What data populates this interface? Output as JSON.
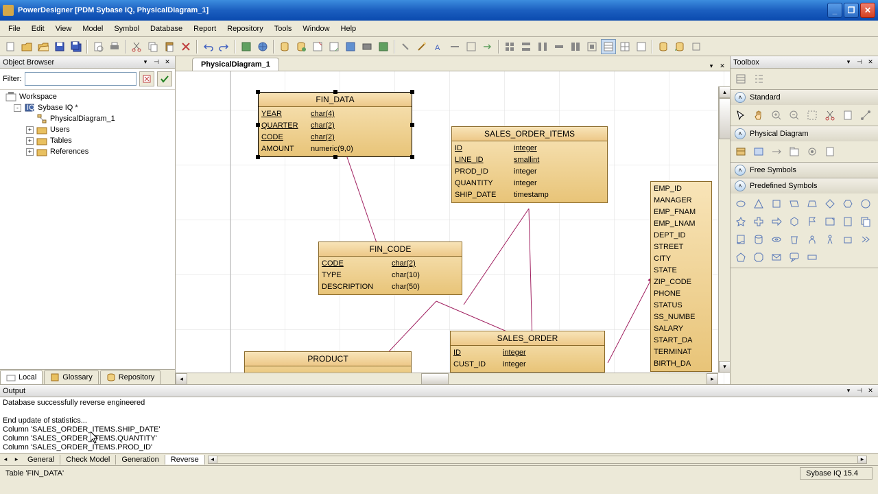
{
  "title": "PowerDesigner [PDM Sybase IQ, PhysicalDiagram_1]",
  "menu": [
    "File",
    "Edit",
    "View",
    "Model",
    "Symbol",
    "Database",
    "Report",
    "Repository",
    "Tools",
    "Window",
    "Help"
  ],
  "objectBrowser": {
    "title": "Object Browser",
    "filterLabel": "Filter:",
    "tree": {
      "root": "Workspace",
      "model": "Sybase IQ *",
      "diagram": "PhysicalDiagram_1",
      "folders": [
        "Users",
        "Tables",
        "References"
      ]
    },
    "tabs": [
      "Local",
      "Glossary",
      "Repository"
    ]
  },
  "diagramTab": "PhysicalDiagram_1",
  "entities": {
    "fin_data": {
      "name": "FIN_DATA",
      "cols": [
        {
          "n": "YEAR",
          "t": "char(4)",
          "k": "<pk>",
          "u": true
        },
        {
          "n": "QUARTER",
          "t": "char(2)",
          "k": "<pk>",
          "u": true
        },
        {
          "n": "CODE",
          "t": "char(2)",
          "k": "<pk,fk>",
          "u": true
        },
        {
          "n": "AMOUNT",
          "t": "numeric(9,0)",
          "k": "",
          "u": false
        }
      ]
    },
    "sales_order_items": {
      "name": "SALES_ORDER_ITEMS",
      "cols": [
        {
          "n": "ID",
          "t": "integer",
          "k": "<pk,fk1>",
          "u": true
        },
        {
          "n": "LINE_ID",
          "t": "smallint",
          "k": "<pk>",
          "u": true
        },
        {
          "n": "PROD_ID",
          "t": "integer",
          "k": "<fk2>",
          "u": false
        },
        {
          "n": "QUANTITY",
          "t": "integer",
          "k": "",
          "u": false
        },
        {
          "n": "SHIP_DATE",
          "t": "timestamp",
          "k": "",
          "u": false
        }
      ]
    },
    "fin_code": {
      "name": "FIN_CODE",
      "cols": [
        {
          "n": "CODE",
          "t": "char(2)",
          "k": "<pk>",
          "u": true
        },
        {
          "n": "TYPE",
          "t": "char(10)",
          "k": "",
          "u": false
        },
        {
          "n": "DESCRIPTION",
          "t": "char(50)",
          "k": "",
          "u": false
        }
      ]
    },
    "sales_order": {
      "name": "SALES_ORDER",
      "cols": [
        {
          "n": "ID",
          "t": "integer",
          "k": "<pk>",
          "u": true
        },
        {
          "n": "CUST_ID",
          "t": "integer",
          "k": "<fk3>",
          "u": false
        }
      ]
    },
    "product": {
      "name": "PRODUCT",
      "cols": []
    },
    "employee": {
      "cols": [
        "EMP_ID",
        "MANAGER",
        "EMP_FNAM",
        "EMP_LNAM",
        "DEPT_ID",
        "STREET",
        "CITY",
        "STATE",
        "ZIP_CODE",
        "PHONE",
        "STATUS",
        "SS_NUMBE",
        "SALARY",
        "START_DA",
        "TERMINAT",
        "BIRTH_DA"
      ]
    }
  },
  "toolbox": {
    "title": "Toolbox",
    "sections": [
      "Standard",
      "Physical Diagram",
      "Free Symbols",
      "Predefined Symbols"
    ]
  },
  "output": {
    "title": "Output",
    "lines": [
      "Column 'SALES_ORDER_ITEMS.PROD_ID'",
      "Column 'SALES_ORDER_ITEMS.QUANTITY'",
      "Column 'SALES_ORDER_ITEMS.SHIP_DATE'",
      "End update of statistics...",
      "",
      "Database successfully reverse engineered"
    ],
    "tabs": [
      "General",
      "Check Model",
      "Generation",
      "Reverse"
    ]
  },
  "status": {
    "left": "Table 'FIN_DATA'",
    "right": "Sybase IQ 15.4"
  }
}
